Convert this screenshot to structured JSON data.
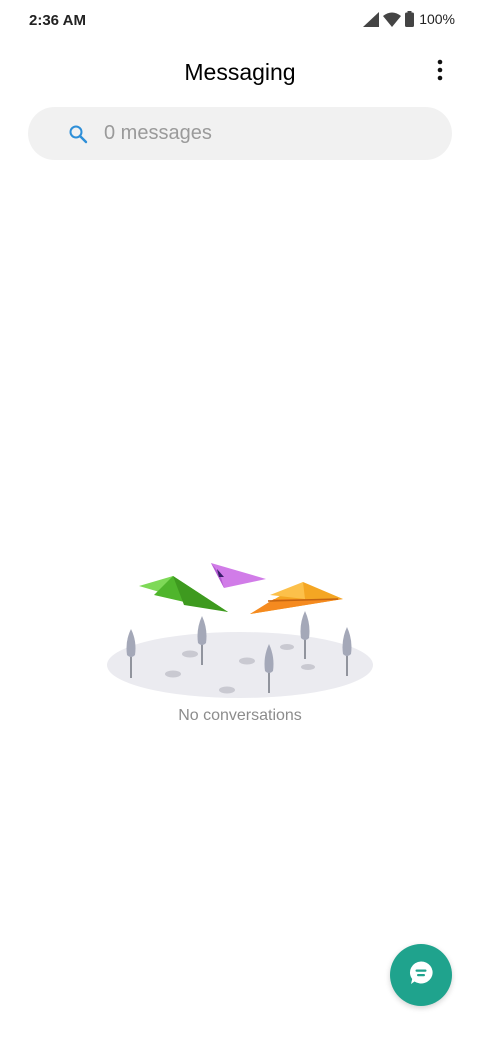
{
  "status_bar": {
    "time": "2:36 AM",
    "battery": "100%",
    "icons": [
      "signal-icon",
      "wifi-icon",
      "battery-icon"
    ]
  },
  "header": {
    "title": "Messaging",
    "more_icon": "more-vertical-icon"
  },
  "search": {
    "placeholder": "0 messages",
    "icon": "search-icon"
  },
  "empty_state": {
    "text": "No conversations",
    "illustration": "paper-planes-over-trees"
  },
  "fab": {
    "icon": "compose-message-icon",
    "color": "#1fa38d"
  },
  "colors": {
    "accent": "#1fa38d",
    "search_icon": "#2e8fd8"
  }
}
